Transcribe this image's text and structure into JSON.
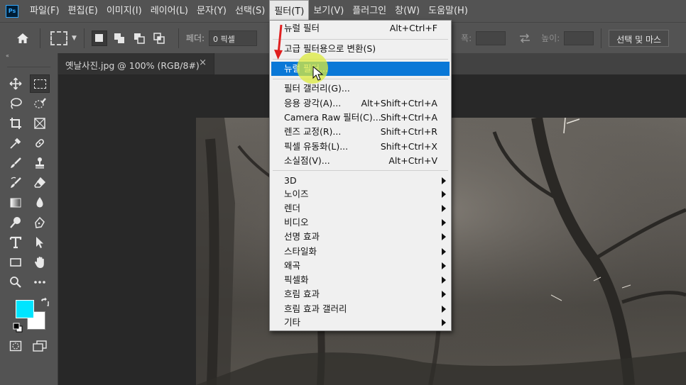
{
  "app": {
    "logo_text": "Ps"
  },
  "menubar": {
    "items": [
      "파일(F)",
      "편집(E)",
      "이미지(I)",
      "레이어(L)",
      "문자(Y)",
      "선택(S)",
      "필터(T)",
      "보기(V)",
      "플러그인",
      "창(W)",
      "도움말(H)"
    ],
    "active_index": 6
  },
  "options_bar": {
    "feather_label": "페더:",
    "feather_value": "0 픽셀",
    "width_label": "폭:",
    "height_label": "높이:",
    "select_mask_button": "선택 및 마스"
  },
  "document": {
    "tab_title": "옛날사진.jpg @ 100% (RGB/8#)",
    "close_glyph": "×"
  },
  "toolbar": {
    "collapse_glyph": "«",
    "tools": [
      "move-icon",
      "marquee-icon",
      "lasso-icon",
      "quick-select-icon",
      "crop-icon",
      "frame-icon",
      "eyedropper-icon",
      "healing-icon",
      "brush-icon",
      "stamp-icon",
      "history-brush-icon",
      "eraser-icon",
      "gradient-icon",
      "blur-icon",
      "dodge-icon",
      "pen-icon",
      "type-icon",
      "path-select-icon",
      "rectangle-icon",
      "hand-icon",
      "zoom-icon",
      "more-icon"
    ],
    "foreground_color": "#00e5ff",
    "background_color": "#ffffff"
  },
  "filter_menu": {
    "items": [
      {
        "label": "뉴럴 필터",
        "shortcut": "Alt+Ctrl+F"
      },
      {
        "label": "고급 필터용으로 변환(S)",
        "shortcut": ""
      },
      {
        "label": "뉴럴 필터...",
        "shortcut": "",
        "highlighted": true
      },
      {
        "label": "필터 갤러리(G)...",
        "shortcut": ""
      },
      {
        "label": "응용 광각(A)...",
        "shortcut": "Alt+Shift+Ctrl+A"
      },
      {
        "label": "Camera Raw 필터(C)...",
        "shortcut": "Shift+Ctrl+A"
      },
      {
        "label": "렌즈 교정(R)...",
        "shortcut": "Shift+Ctrl+R"
      },
      {
        "label": "픽셀 유동화(L)...",
        "shortcut": "Shift+Ctrl+X"
      },
      {
        "label": "소실점(V)...",
        "shortcut": "Alt+Ctrl+V"
      },
      {
        "label": "3D",
        "submenu": true
      },
      {
        "label": "노이즈",
        "submenu": true
      },
      {
        "label": "렌더",
        "submenu": true
      },
      {
        "label": "비디오",
        "submenu": true
      },
      {
        "label": "선명 효과",
        "submenu": true
      },
      {
        "label": "스타일화",
        "submenu": true
      },
      {
        "label": "왜곡",
        "submenu": true
      },
      {
        "label": "픽셀화",
        "submenu": true
      },
      {
        "label": "흐림 효과",
        "submenu": true
      },
      {
        "label": "흐림 효과 갤러리",
        "submenu": true
      },
      {
        "label": "기타",
        "submenu": true
      }
    ]
  },
  "colors": {
    "highlight": "#0a78d7",
    "annotation_arrow": "#e02020",
    "cursor_glow": "#dceb3c"
  }
}
